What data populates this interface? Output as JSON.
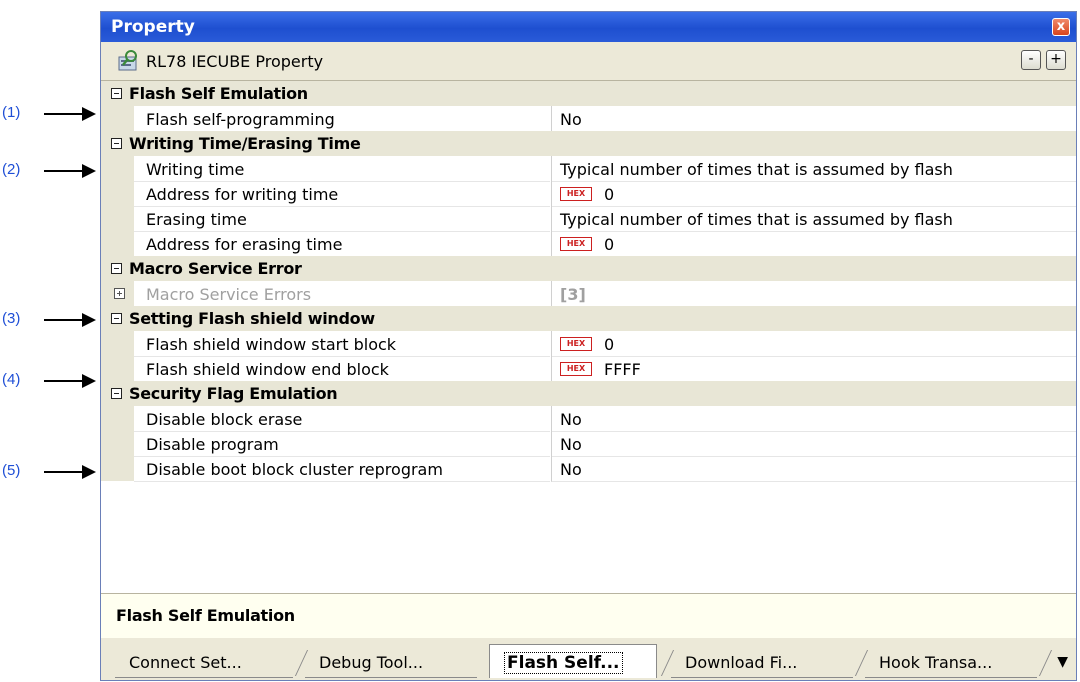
{
  "callouts": [
    "(1)",
    "(2)",
    "(3)",
    "(4)",
    "(5)"
  ],
  "window": {
    "title": "Property",
    "close_label": "x",
    "header_name": "RL78 IECUBE Property",
    "collapse_label": "-",
    "expand_label": "+"
  },
  "grid": {
    "cat_flash_self": "Flash Self Emulation",
    "flash_self_programming": {
      "key": "Flash self-programming",
      "value": "No"
    },
    "cat_writing": "Writing Time/Erasing Time",
    "writing_time": {
      "key": "Writing time",
      "value": "Typical number of times that is assumed by flash"
    },
    "addr_writing": {
      "key": "Address for writing time",
      "badge": "HEX",
      "value": "0"
    },
    "erasing_time": {
      "key": "Erasing time",
      "value": "Typical number of times that is assumed by flash"
    },
    "addr_erasing": {
      "key": "Address for erasing time",
      "badge": "HEX",
      "value": "0"
    },
    "cat_macro": "Macro Service Error",
    "macro_errors": {
      "key": "Macro Service Errors",
      "value": "[3]"
    },
    "cat_shield": "Setting Flash shield window",
    "shield_start": {
      "key": "Flash shield window start block",
      "badge": "HEX",
      "value": "0"
    },
    "shield_end": {
      "key": "Flash shield window end block",
      "badge": "HEX",
      "value": "FFFF"
    },
    "cat_security": "Security Flag Emulation",
    "disable_block_erase": {
      "key": "Disable block erase",
      "value": "No"
    },
    "disable_program": {
      "key": "Disable program",
      "value": "No"
    },
    "disable_boot": {
      "key": "Disable boot block cluster reprogram",
      "value": "No"
    }
  },
  "description": "Flash Self Emulation",
  "tabs": [
    "Connect Set...",
    "Debug Tool...",
    "Flash  Self...",
    "Download Fi...",
    "Hook Transa..."
  ],
  "tab_more": "▼",
  "colors": {
    "title_bar": "#1e4fd0",
    "hex_badge": "#cc2020",
    "callout_text": "#1f4fd6"
  }
}
